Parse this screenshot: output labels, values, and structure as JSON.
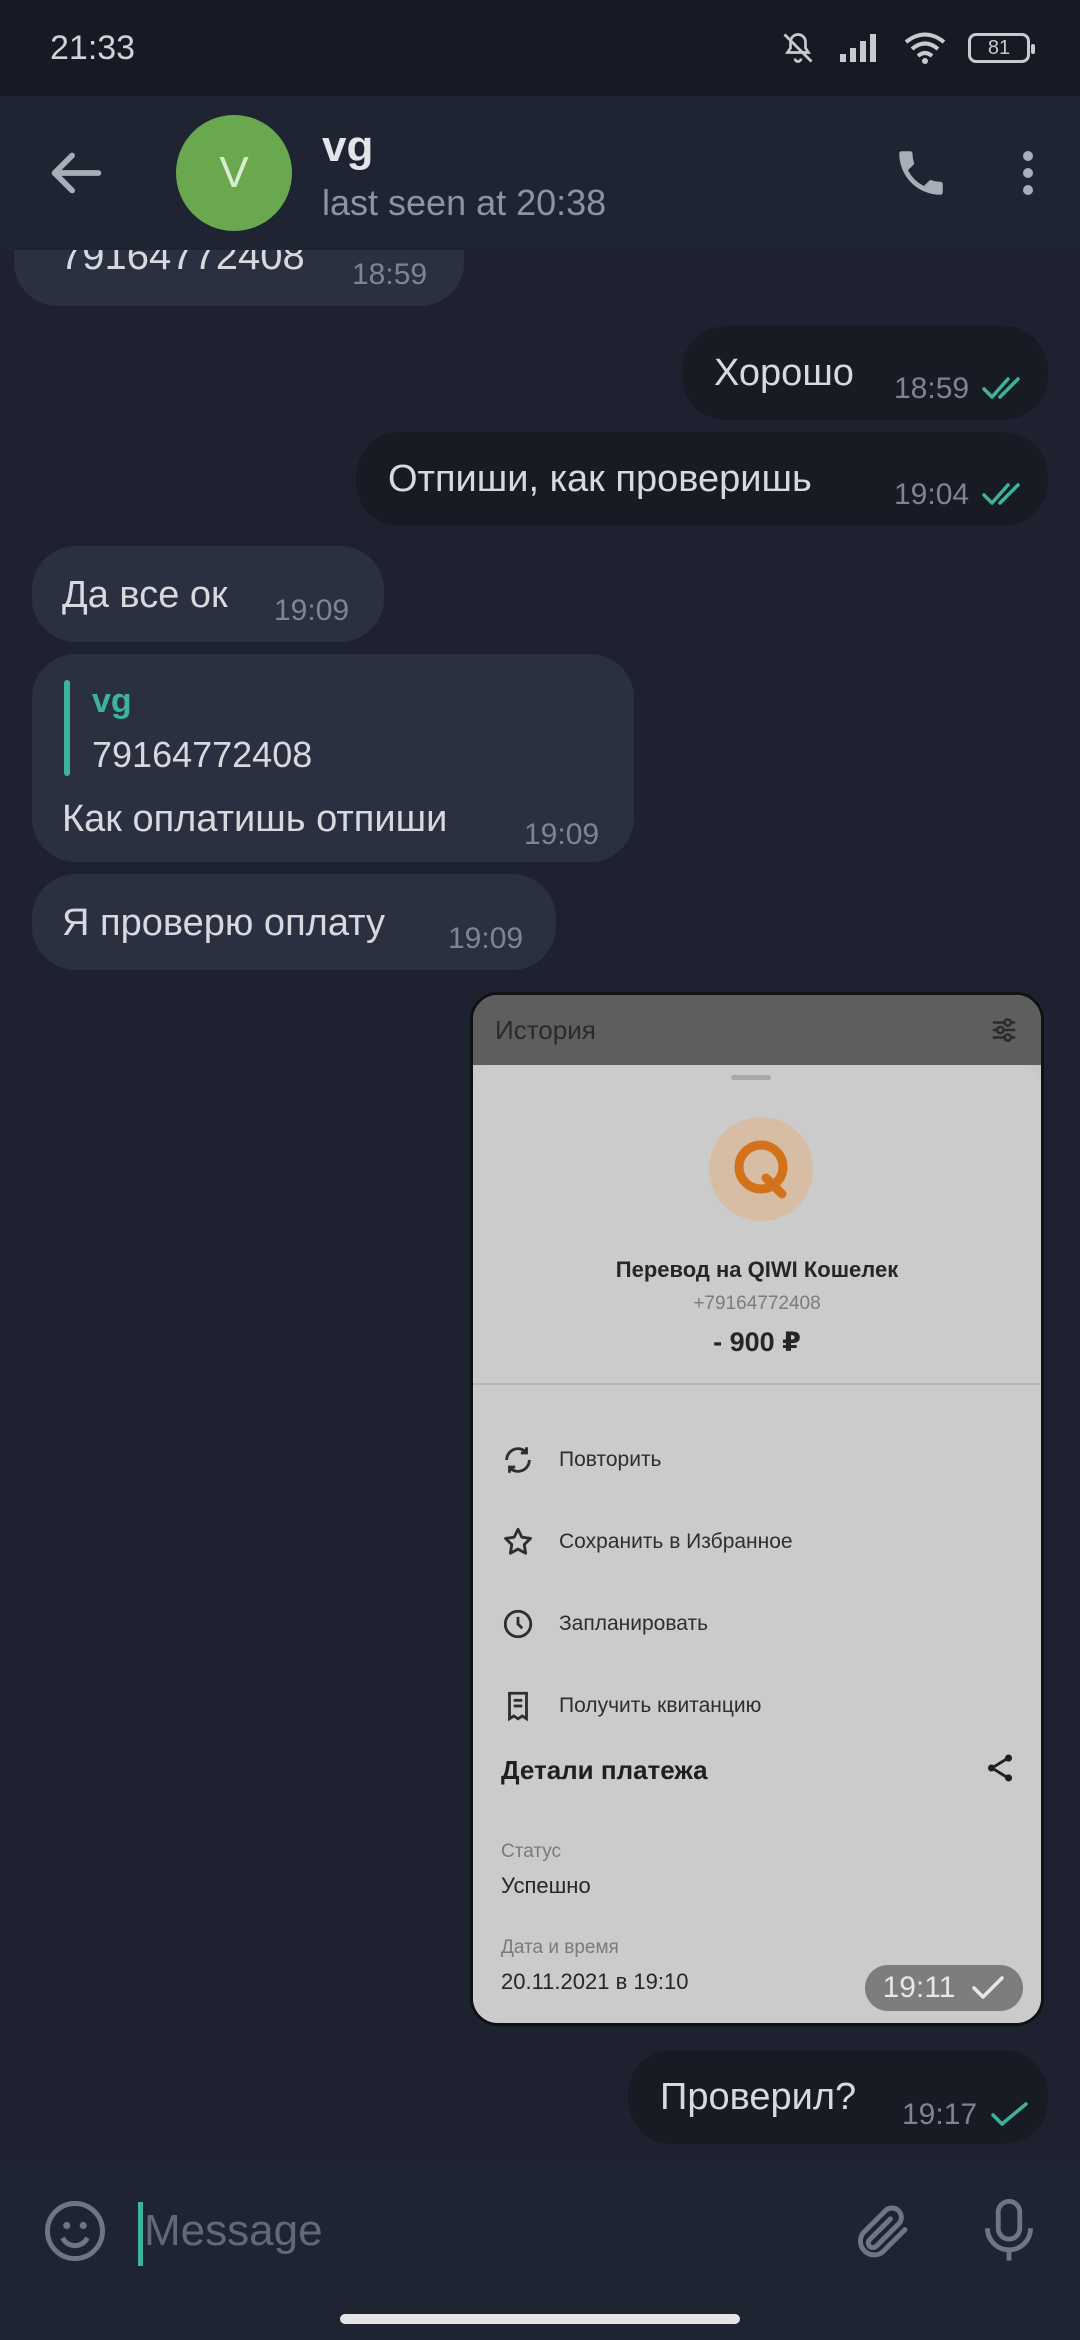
{
  "status_bar": {
    "time": "21:33",
    "battery": "81"
  },
  "header": {
    "avatar_letter": "V",
    "name": "vg",
    "last_seen": "last seen at 20:38"
  },
  "messages": [
    {
      "dir": "in",
      "text": "79164772408",
      "time": "18:59"
    },
    {
      "dir": "out",
      "text": "Хорошо",
      "time": "18:59",
      "status": "read"
    },
    {
      "dir": "out",
      "text": "Отпиши, как проверишь",
      "time": "19:04",
      "status": "read"
    },
    {
      "dir": "in",
      "text": "Да все ок",
      "time": "19:09"
    },
    {
      "dir": "in",
      "reply_name": "vg",
      "reply_text": "79164772408",
      "text": "Как оплатишь отпиши",
      "time": "19:09"
    },
    {
      "dir": "in",
      "text": "Я проверю оплату",
      "time": "19:09"
    },
    {
      "dir": "out",
      "type": "photo",
      "time": "19:11",
      "status": "sent"
    },
    {
      "dir": "out",
      "text": "Проверил?",
      "time": "19:17",
      "status": "sent"
    }
  ],
  "photo": {
    "top_title": "История",
    "transfer_title": "Перевод на QIWI Кошелек",
    "phone": "+79164772408",
    "amount": "- 900 ₽",
    "actions": [
      "Повторить",
      "Сохранить в Избранное",
      "Запланировать",
      "Получить квитанцию"
    ],
    "details_title": "Детали платежа",
    "status_label": "Статус",
    "status_value": "Успешно",
    "date_label": "Дата и время",
    "date_value": "20.11.2021 в 19:10"
  },
  "input": {
    "placeholder": "Message"
  },
  "colors": {
    "accent": "#3fb39a",
    "avatar": "#6aa84f",
    "background": "#1e2230",
    "incoming": "#2b3040",
    "outgoing": "#181b24"
  }
}
